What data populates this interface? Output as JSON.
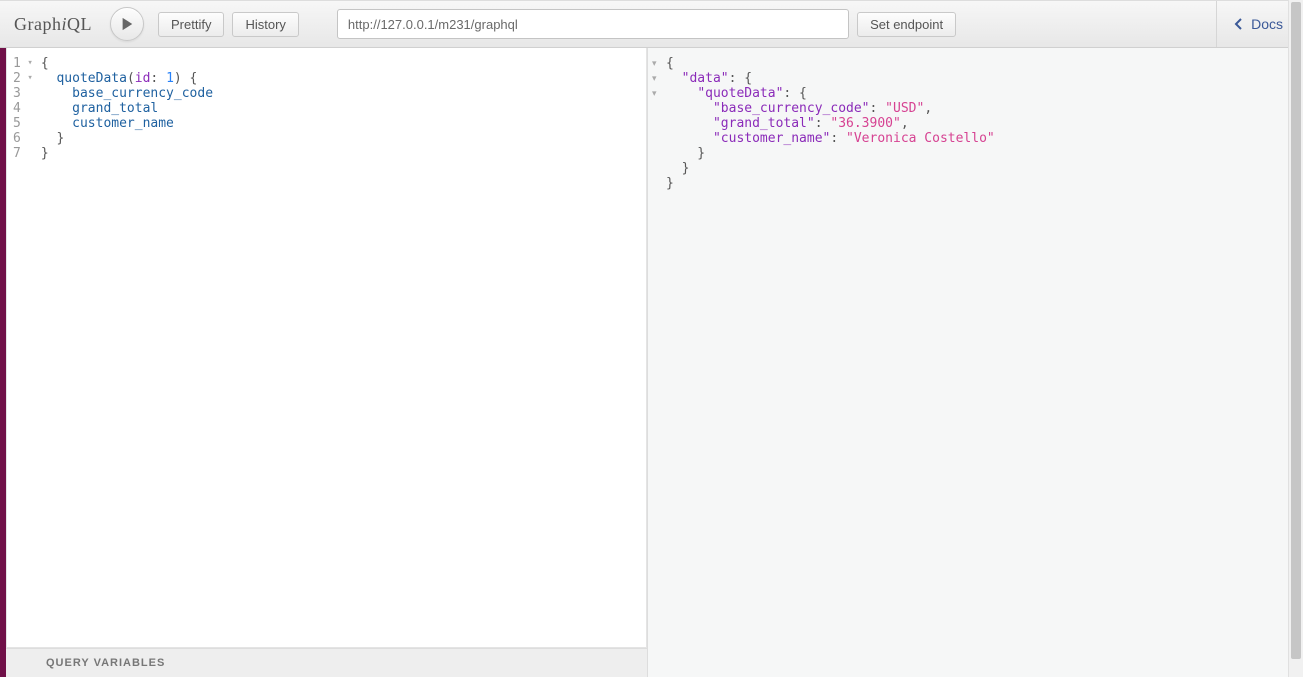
{
  "header": {
    "logo_a": "Graph",
    "logo_i": "i",
    "logo_b": "QL",
    "prettify_label": "Prettify",
    "history_label": "History",
    "endpoint_value": "http://127.0.0.1/m231/graphql",
    "set_endpoint_label": "Set endpoint",
    "docs_label": "Docs"
  },
  "editor": {
    "line_numbers": [
      "1",
      "2",
      "3",
      "4",
      "5",
      "6",
      "7"
    ],
    "fold_lines": [
      0,
      1
    ],
    "query": {
      "root_open": "{",
      "call_name": "quoteData",
      "arg_name": "id",
      "arg_value": "1",
      "fields": [
        "base_currency_code",
        "grand_total",
        "customer_name"
      ],
      "inner_close": "}",
      "root_close": "}"
    }
  },
  "result": {
    "data_key": "data",
    "quote_key": "quoteData",
    "pairs": [
      {
        "k": "base_currency_code",
        "v": "USD",
        "trail": ","
      },
      {
        "k": "grand_total",
        "v": "36.3900",
        "trail": ","
      },
      {
        "k": "customer_name",
        "v": "Veronica Costello",
        "trail": ""
      }
    ]
  },
  "footer": {
    "query_variables_label": "QUERY VARIABLES"
  }
}
